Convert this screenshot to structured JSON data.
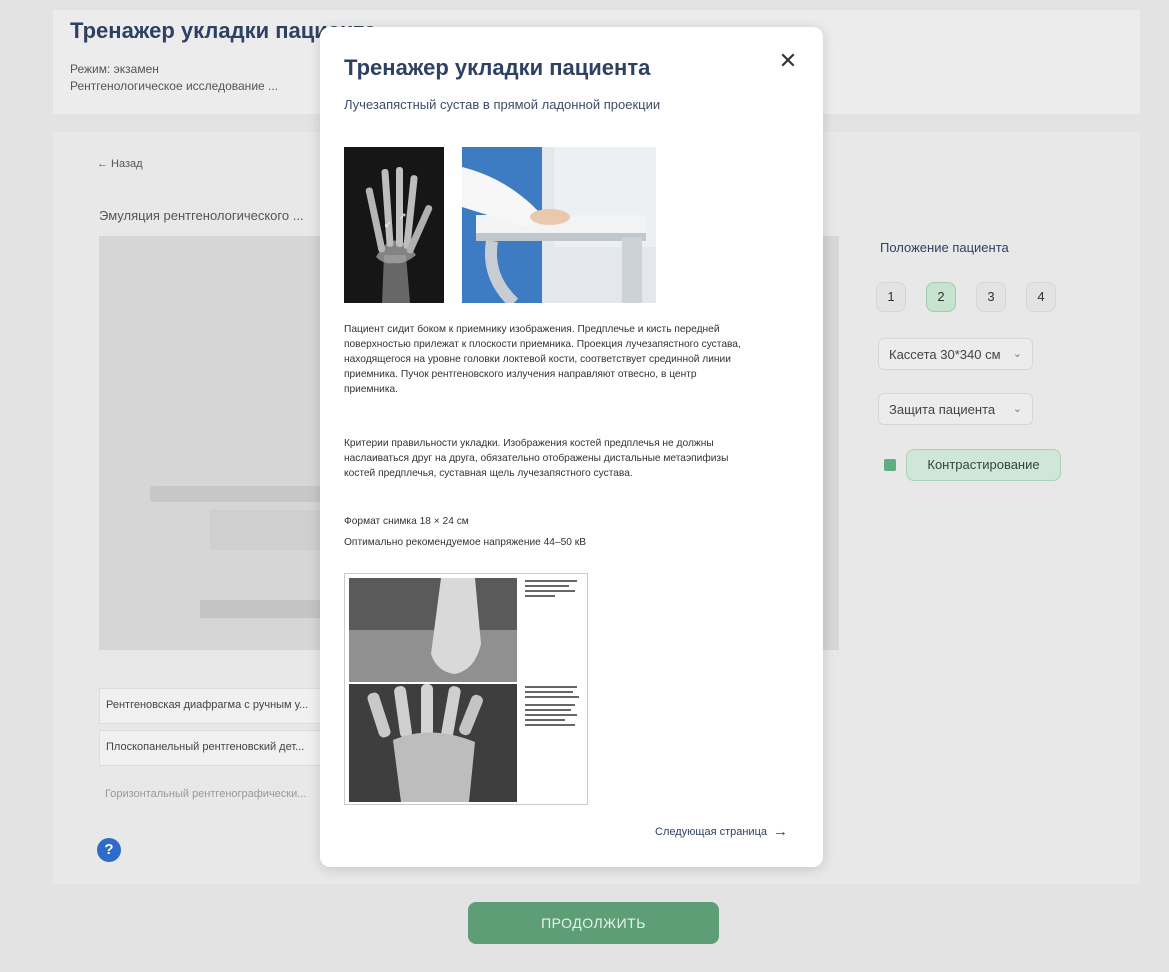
{
  "header": {
    "title": "Тренажер укладки пациента",
    "mode": "Режим: экзамен",
    "study": "Рентгенологическое исследование ..."
  },
  "main": {
    "back_label": "← Назад",
    "emulation_label": "Эмуляция рентгенологического ..."
  },
  "equipment": [
    {
      "label": "Рентгеновская диафрагма с ручным у..."
    },
    {
      "label": "Плоскопанельный рентгеновский дет..."
    },
    {
      "label": "Горизонтальный рентгенографически..."
    }
  ],
  "right_panel": {
    "position_title": "Положение пациента",
    "positions": [
      "1",
      "2",
      "3",
      "4"
    ],
    "active_position": "2",
    "cassette": "Кассета 30*340 см",
    "protection": "Защита пациента",
    "contrast": "Контрастирование",
    "contrast_checked": true
  },
  "help_icon": "question-circle-icon",
  "continue_label": "ПРОДОЛЖИТЬ",
  "modal": {
    "title": "Тренажер укладки пациента",
    "subtitle": "Лучезапястный сустав в прямой ладонной проекции",
    "close_icon": "close-icon",
    "paragraph_1": "Пациент сидит боком к приемнику изображения. Предплечье и кисть передней поверхностью прилежат к плоскости приемника. Проекция лучезапястного сустава, находящегося на уровне головки локтевой кости, соответствует срединной линии приемника. Пучок рентгеновского излучения направляют отвесно, в центр приемника.",
    "paragraph_2": "Критерии правильности укладки. Изображения костей предплечья не должны наслаиваться друг на друга, обязательно отображены дистальные метаэпифизы костей предплечья, суставная щель лучезапястного сустава.",
    "paragraph_3": "Формат снимка 18 × 24 см",
    "paragraph_4": "Оптимально рекомендуемое напряжение 44–50 кВ",
    "next_label": "Следующая страница",
    "next_icon": "arrow-right-icon"
  },
  "colors": {
    "title": "#2f4163",
    "accent_green": "#5d9e77",
    "help_blue": "#2f6cc9"
  }
}
